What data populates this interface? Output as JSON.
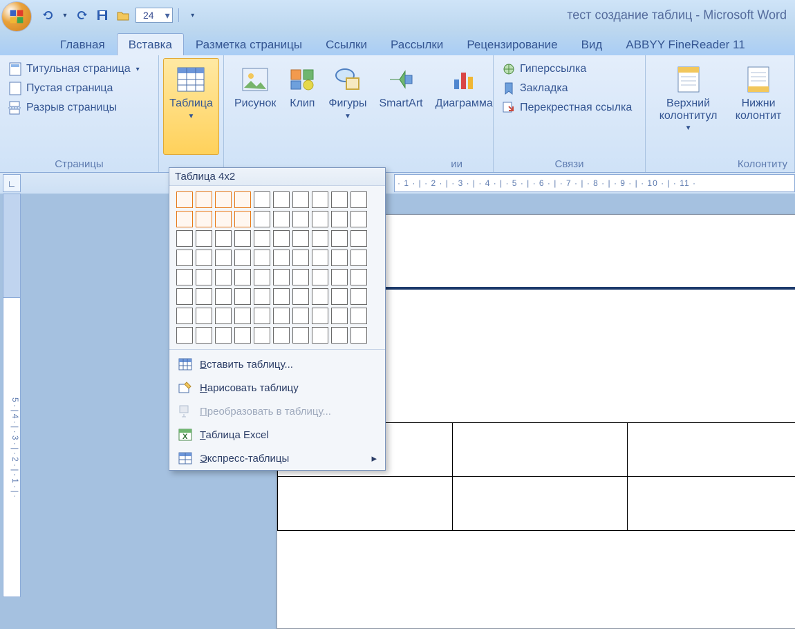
{
  "titlebar": {
    "title": "тест создание таблиц - Microsoft Word",
    "fontsize": "24"
  },
  "tabs": [
    "Главная",
    "Вставка",
    "Разметка страницы",
    "Ссылки",
    "Рассылки",
    "Рецензирование",
    "Вид",
    "ABBYY FineReader 11"
  ],
  "active_tab": "Вставка",
  "ribbon": {
    "pages_group": {
      "label": "Страницы",
      "items": [
        "Титульная страница",
        "Пустая страница",
        "Разрыв страницы"
      ]
    },
    "tables_group": {
      "button": "Таблица"
    },
    "illus_group": {
      "label_tail": "ии",
      "items": [
        "Рисунок",
        "Клип",
        "Фигуры",
        "SmartArt",
        "Диаграмма"
      ]
    },
    "links_group": {
      "label": "Связи",
      "items": [
        "Гиперссылка",
        "Закладка",
        "Перекрестная ссылка"
      ]
    },
    "headerfooter_group": {
      "label": "Колонтиту",
      "items": [
        "Верхний колонтитул",
        "Нижни колонтит"
      ]
    }
  },
  "table_panel": {
    "header": "Таблица 4x2",
    "grid_cols": 10,
    "grid_rows": 8,
    "sel_cols": 4,
    "sel_rows": 2,
    "items": {
      "insert": "Вставить таблицу...",
      "draw": "Нарисовать таблицу",
      "convert": "Преобразовать в таблицу...",
      "excel": "Таблица Excel",
      "quick": "Экспресс-таблицы"
    }
  },
  "hruler_text": " · 1 · | · 2 · | · 3 · | · 4 · | · 5 · | · 6 · | · 7 · | · 8 · | · 9 · | · 10 · | · 11 ·",
  "vruler_text": "5 · | 4 · | · 3 · | · 2 · | · 1 · | ·"
}
